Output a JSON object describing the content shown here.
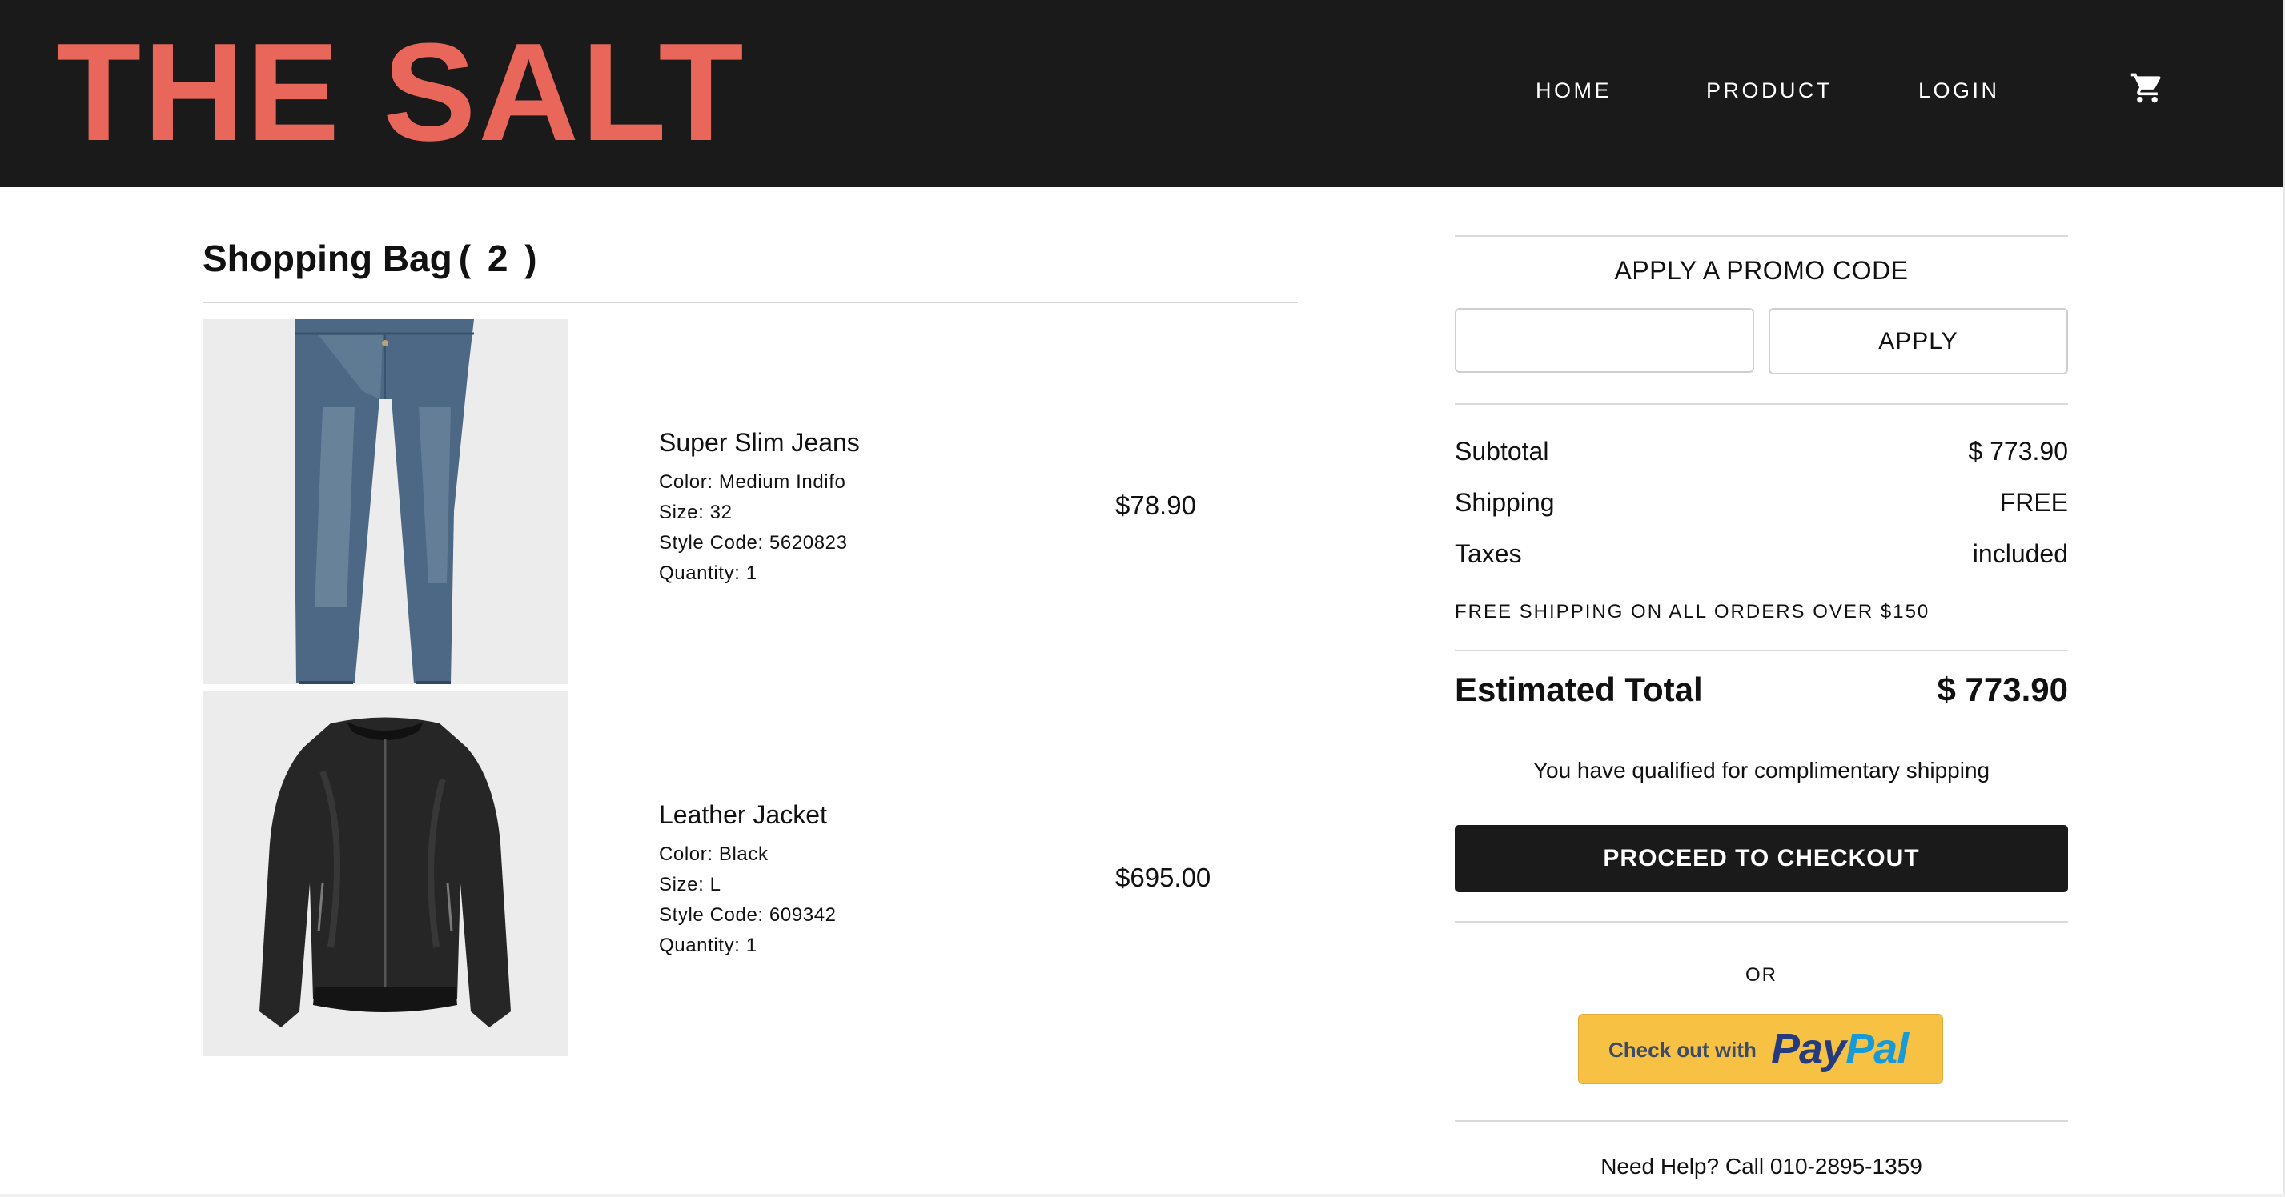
{
  "brand": {
    "name": "THE SALT",
    "color": "#e8665a"
  },
  "nav": {
    "links": [
      "HOME",
      "PRODUCT",
      "LOGIN"
    ],
    "cart_icon": "shopping-cart-icon"
  },
  "bag": {
    "title": "Shopping Bag",
    "count": "( 2 )",
    "items": [
      {
        "name": "Super Slim Jeans",
        "color": "Color: Medium Indifo",
        "size": "Size: 32",
        "style_code": "Style Code: 5620823",
        "quantity": "Quantity: 1",
        "price": "$78.90",
        "image": "jeans-image"
      },
      {
        "name": "Leather Jacket",
        "color": "Color: Black",
        "size": "Size: L",
        "style_code": "Style Code: 609342",
        "quantity": "Quantity: 1",
        "price": "$695.00",
        "image": "jacket-image"
      }
    ]
  },
  "summary": {
    "promo_title": "APPLY A PROMO CODE",
    "promo_value": "",
    "apply_label": "APPLY",
    "subtotal_label": "Subtotal",
    "subtotal_value": "$ 773.90",
    "shipping_label": "Shipping",
    "shipping_value": "FREE",
    "taxes_label": "Taxes",
    "taxes_value": "included",
    "free_shipping_note": "FREE SHIPPING ON ALL ORDERS OVER $150",
    "estimated_label": "Estimated Total",
    "estimated_value": "$ 773.90",
    "qualified_text": "You have qualified for complimentary shipping",
    "checkout_label": "PROCEED TO CHECKOUT",
    "or_text": "OR",
    "paypal": {
      "check_text": "Check out with",
      "logo_pay": "Pay",
      "logo_pal": "Pal"
    },
    "help_text": "Need Help? Call 010-2895-1359"
  }
}
